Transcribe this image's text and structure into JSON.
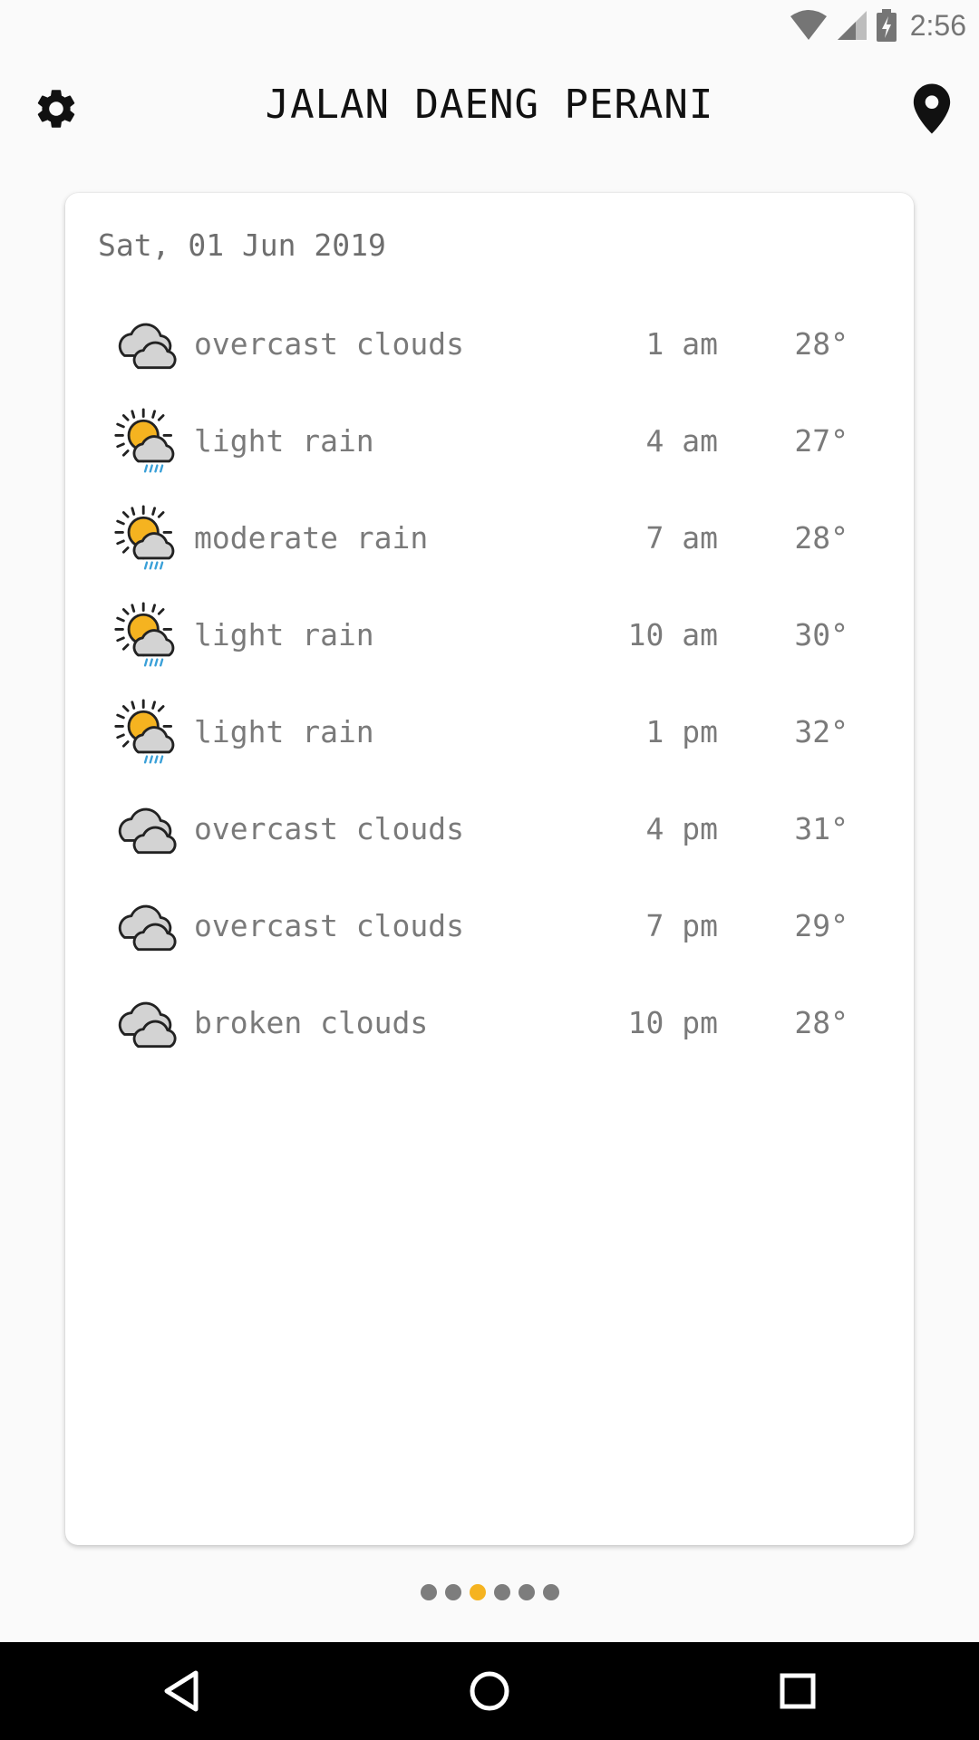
{
  "status_bar": {
    "time": "2:56",
    "icons": [
      "wifi-icon",
      "signal-icon",
      "battery-charging-icon"
    ]
  },
  "header": {
    "title": "JALAN DAENG PERANI",
    "left_icon": "gear-icon",
    "right_icon": "location-pin-icon"
  },
  "card": {
    "date": "Sat, 01 Jun 2019",
    "rows": [
      {
        "icon": "cloud-icon",
        "description": "overcast clouds",
        "time": "1 am",
        "temp": "28°"
      },
      {
        "icon": "sun-rain-icon",
        "description": "light rain",
        "time": "4 am",
        "temp": "27°"
      },
      {
        "icon": "sun-rain-icon",
        "description": "moderate rain",
        "time": "7 am",
        "temp": "28°"
      },
      {
        "icon": "sun-rain-icon",
        "description": "light rain",
        "time": "10 am",
        "temp": "30°"
      },
      {
        "icon": "sun-rain-icon",
        "description": "light rain",
        "time": "1 pm",
        "temp": "32°"
      },
      {
        "icon": "cloud-icon",
        "description": "overcast clouds",
        "time": "4 pm",
        "temp": "31°"
      },
      {
        "icon": "cloud-icon",
        "description": "overcast clouds",
        "time": "7 pm",
        "temp": "29°"
      },
      {
        "icon": "cloud-icon",
        "description": "broken clouds",
        "time": "10 pm",
        "temp": "28°"
      }
    ]
  },
  "pager": {
    "count": 6,
    "active_index": 2
  },
  "colors": {
    "accent": "#f5b320",
    "rain": "#3aa0d8",
    "text": "#7a7a7a",
    "title": "#111111"
  },
  "nav_bar": {
    "icons": [
      "back-icon",
      "home-icon",
      "recents-icon"
    ]
  }
}
